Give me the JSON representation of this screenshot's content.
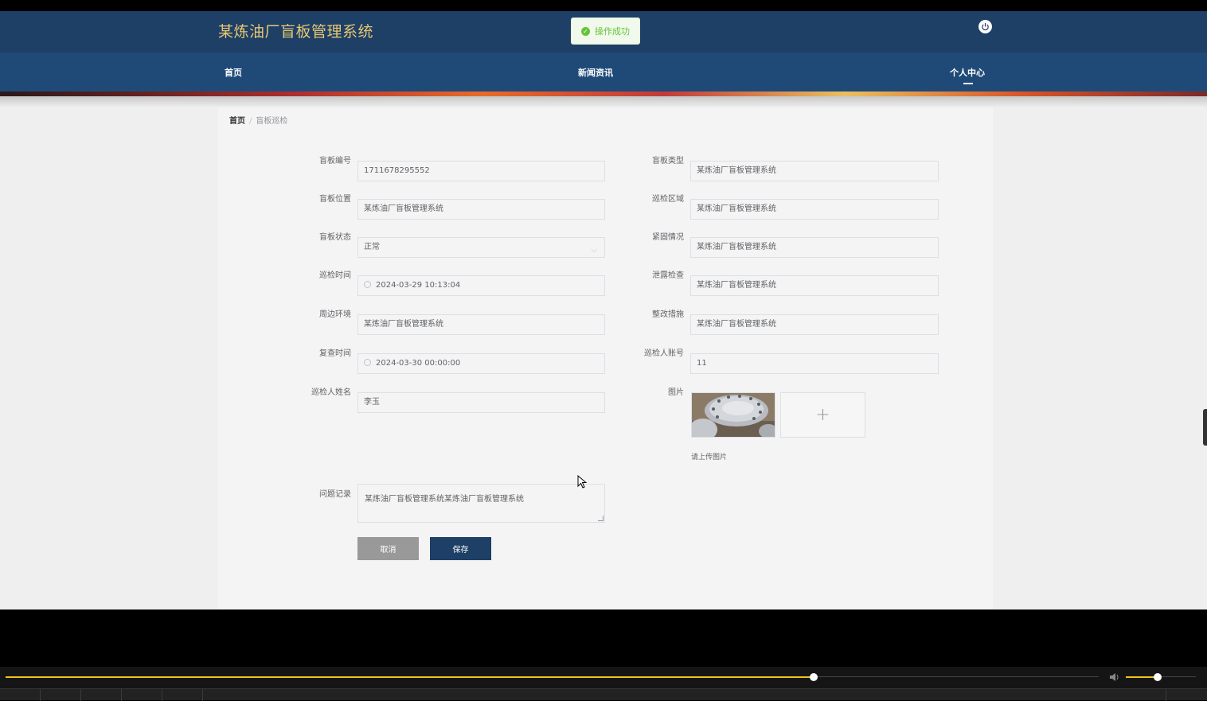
{
  "header": {
    "site_title": "某炼油厂盲板管理系统",
    "toast_text": "操作成功"
  },
  "nav": {
    "items": [
      "首页",
      "新闻资讯",
      "个人中心"
    ],
    "active": "个人中心"
  },
  "breadcrumb": {
    "home": "首页",
    "separator": "/",
    "current": "盲板巡检"
  },
  "form": {
    "blind_no": {
      "label": "盲板编号",
      "value": "1711678295552"
    },
    "blind_type": {
      "label": "盲板类型",
      "value": "某炼油厂盲板管理系统"
    },
    "blind_location": {
      "label": "盲板位置",
      "value": "某炼油厂盲板管理系统"
    },
    "inspection_area": {
      "label": "巡检区域",
      "value": "某炼油厂盲板管理系统"
    },
    "blind_status": {
      "label": "盲板状态",
      "value": "正常"
    },
    "fastening": {
      "label": "紧固情况",
      "value": "某炼油厂盲板管理系统"
    },
    "inspection_time": {
      "label": "巡检时间",
      "value": "2024-03-29 10:13:04"
    },
    "leak_check": {
      "label": "泄露检查",
      "value": "某炼油厂盲板管理系统"
    },
    "surroundings": {
      "label": "周边环境",
      "value": "某炼油厂盲板管理系统"
    },
    "rectification": {
      "label": "整改措施",
      "value": "某炼油厂盲板管理系统"
    },
    "recheck_time": {
      "label": "复查时间",
      "value": "2024-03-30 00:00:00"
    },
    "inspector_account": {
      "label": "巡检人账号",
      "value": "11"
    },
    "inspector_name": {
      "label": "巡检人姓名",
      "value": "李玉"
    },
    "image": {
      "label": "图片",
      "tip": "请上传图片",
      "plus": "+"
    },
    "problem_record": {
      "label": "问题记录",
      "value": "某炼油厂盲板管理系统某炼油厂盲板管理系统"
    },
    "cancel_label": "取消",
    "save_label": "保存"
  },
  "colors": {
    "header_bg": "#1e3f66",
    "nav_bg": "#1f4a78",
    "title_gold": "#e8c872",
    "save_button": "#1e3f66",
    "cancel_button": "#999999",
    "progress": "#f0c419"
  },
  "player": {
    "progress": 0.739,
    "volume": 0.45
  }
}
